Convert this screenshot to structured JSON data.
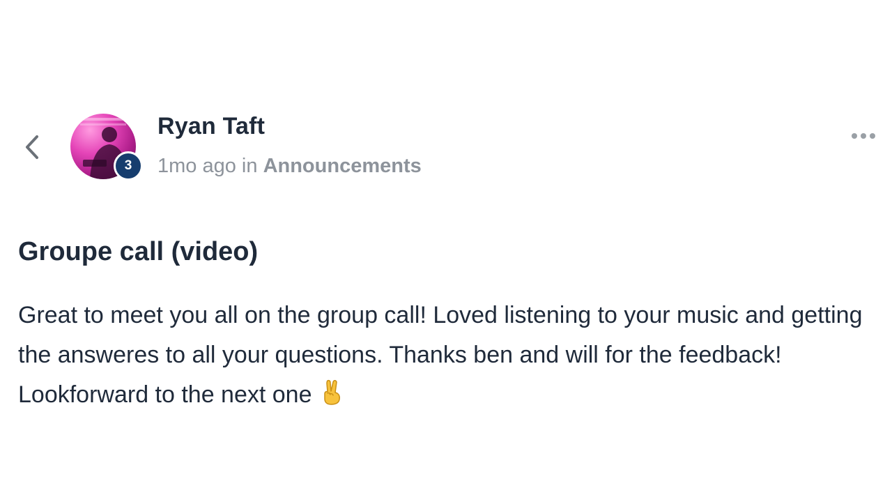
{
  "post": {
    "author": {
      "name": "Ryan Taft",
      "level_badge": "3"
    },
    "meta": {
      "time_ago": "1mo ago",
      "in_word": "in",
      "category": "Announcements"
    },
    "title": "Groupe call (video)",
    "body": "Great to meet you all on the group call! Loved listening to your music and getting the answeres to all your questions. Thanks ben and will for the feedback! Lookforward to the next one",
    "body_emoji": "victory-hand-emoji"
  },
  "icons": {
    "back": "chevron-left-icon",
    "more": "more-horizontal-icon"
  },
  "colors": {
    "text_primary": "#1f2a3a",
    "text_muted": "#8d939b",
    "badge_bg": "#163d6e",
    "avatar_accent": "#e545b8"
  }
}
